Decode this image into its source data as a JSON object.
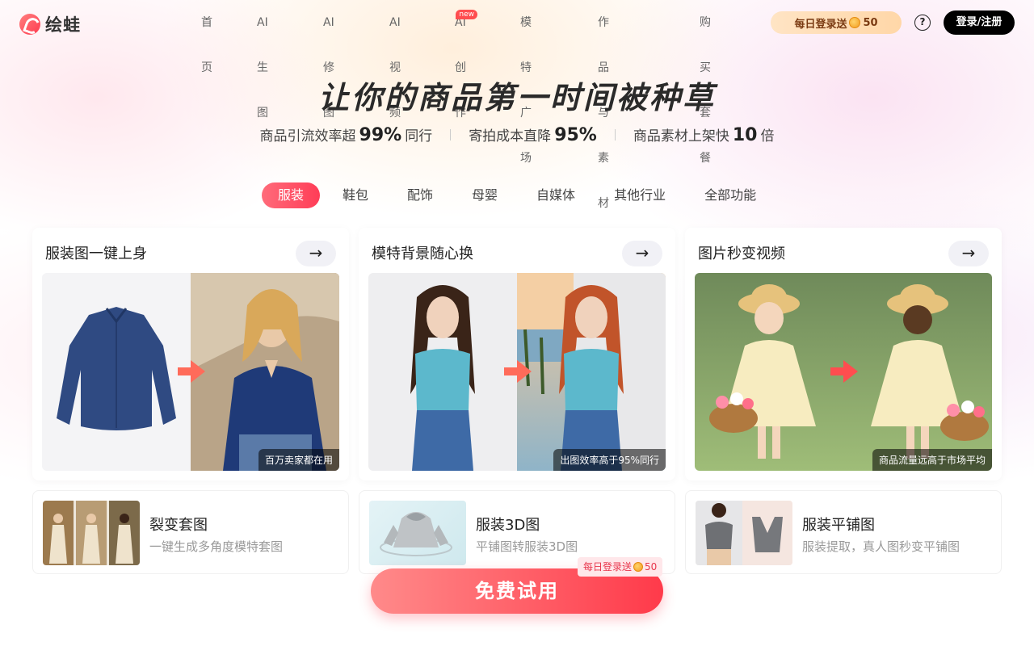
{
  "brand": {
    "name": "绘蛙"
  },
  "nav": {
    "items": [
      {
        "label": "首页"
      },
      {
        "label": "AI生图"
      },
      {
        "label": "AI修图"
      },
      {
        "label": "AI视频"
      },
      {
        "label": "AI创作",
        "badge": "new"
      },
      {
        "label": "模特广场"
      },
      {
        "label": "作品与素材"
      },
      {
        "label": "购买套餐"
      }
    ],
    "login_bonus": {
      "text": "每日登录送",
      "amount": "50"
    },
    "help_symbol": "?",
    "login_label": "登录/注册"
  },
  "hero": {
    "title": "让你的商品第一时间被种草",
    "stats": [
      {
        "prefix": "商品引流效率超",
        "value": "99%",
        "suffix": "同行"
      },
      {
        "prefix": "寄拍成本直降",
        "value": "95%",
        "suffix": ""
      },
      {
        "prefix": "商品素材上架快",
        "value": "10",
        "suffix": "倍"
      }
    ]
  },
  "categories": {
    "tabs": [
      "服装",
      "鞋包",
      "配饰",
      "母婴",
      "自媒体",
      "其他行业",
      "全部功能"
    ],
    "active": "服装"
  },
  "feature_cards": [
    {
      "title": "服装图一键上身",
      "caption": "百万卖家都在用",
      "arrow": "→"
    },
    {
      "title": "模特背景随心换",
      "caption": "出图效率高于95%同行",
      "arrow": "→"
    },
    {
      "title": "图片秒变视频",
      "caption": "商品流量远高于市场平均",
      "arrow": "→"
    }
  ],
  "mini_cards": [
    {
      "title": "裂变套图",
      "subtitle": "一键生成多角度模特套图"
    },
    {
      "title": "服装3D图",
      "subtitle": "平铺图转服装3D图"
    },
    {
      "title": "服装平铺图",
      "subtitle": "服装提取，真人图秒变平铺图"
    }
  ],
  "cta": {
    "label": "免费试用",
    "badge_text": "每日登录送",
    "badge_amount": "50"
  },
  "colors": {
    "accent": "#ff3d57",
    "login_btn": "#000000",
    "bonus_bg": "#ffdcb4"
  },
  "icons": {
    "logo": "frog-logo-icon",
    "help": "question-circle-icon",
    "coin": "coin-icon",
    "arrow": "arrow-right-icon"
  }
}
